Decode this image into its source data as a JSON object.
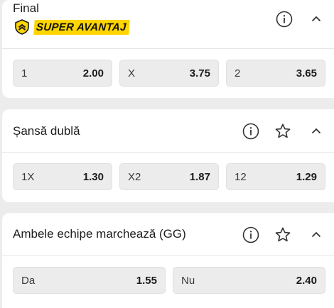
{
  "markets": [
    {
      "title": "Final",
      "badge": "SUPER AVANTAJ",
      "has_info": true,
      "has_favorite": false,
      "outcomes": [
        {
          "label": "1",
          "odd": "2.00"
        },
        {
          "label": "X",
          "odd": "3.75"
        },
        {
          "label": "2",
          "odd": "3.65"
        }
      ]
    },
    {
      "title": "Șansă dublă",
      "has_info": true,
      "has_favorite": true,
      "outcomes": [
        {
          "label": "1X",
          "odd": "1.30"
        },
        {
          "label": "X2",
          "odd": "1.87"
        },
        {
          "label": "12",
          "odd": "1.29"
        }
      ]
    },
    {
      "title": "Ambele echipe marchează (GG)",
      "has_info": true,
      "has_favorite": true,
      "outcomes": [
        {
          "label": "Da",
          "odd": "1.55"
        },
        {
          "label": "Nu",
          "odd": "2.40"
        }
      ]
    }
  ],
  "icons": {
    "info": "info-icon",
    "favorite": "star-icon",
    "collapse": "chevron-up-icon",
    "badge_logo": "super-avantaj-logo-icon"
  },
  "colors": {
    "badge_bg": "#ffd500",
    "page_bg": "#ececec",
    "odd_bg": "#ececec"
  }
}
